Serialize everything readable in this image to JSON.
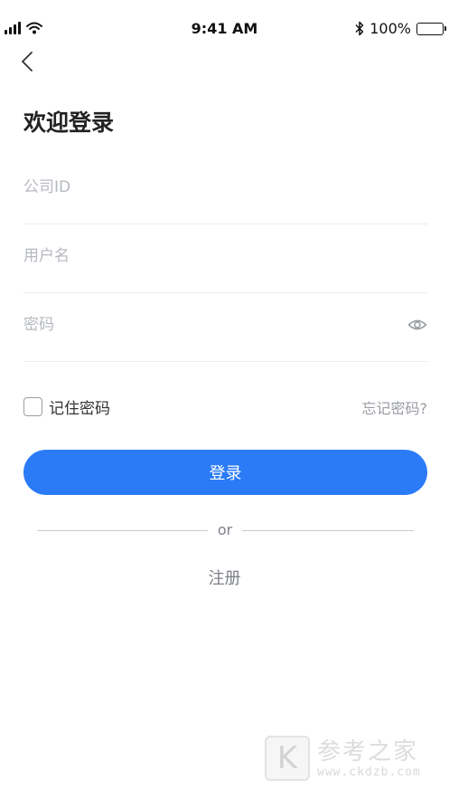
{
  "status_bar": {
    "time": "9:41 AM",
    "battery_percent": "100%",
    "signal_icon": "cellular-signal-icon",
    "wifi_icon": "wifi-icon",
    "bluetooth_icon": "bluetooth-icon",
    "battery_icon": "battery-icon"
  },
  "header": {
    "back_icon": "chevron-left-icon"
  },
  "page": {
    "title": "欢迎登录"
  },
  "form": {
    "company_id": {
      "placeholder": "公司ID",
      "value": ""
    },
    "username": {
      "placeholder": "用户名",
      "value": ""
    },
    "password": {
      "placeholder": "密码",
      "value": "",
      "toggle_icon": "eye-icon"
    },
    "remember_label": "记住密码",
    "remember_checked": false,
    "forgot_label": "忘记密码?",
    "login_label": "登录"
  },
  "alt": {
    "or_label": "or",
    "register_label": "注册"
  },
  "watermark": {
    "logo_letter": "K",
    "text": "参考之家",
    "url": "www.ckdzb.com"
  },
  "colors": {
    "primary": "#2b7bf7",
    "placeholder": "#b6b9c0",
    "muted": "#9a9da4",
    "title": "#222222"
  }
}
